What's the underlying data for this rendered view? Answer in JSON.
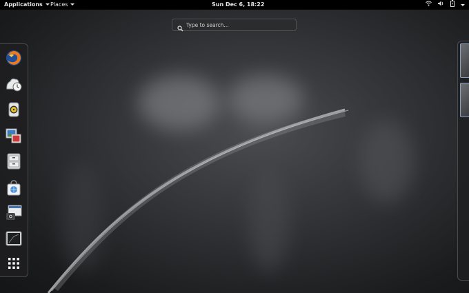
{
  "topbar": {
    "applications_label": "Applications",
    "places_label": "Places",
    "clock": "Sun Dec  6, 18:22",
    "status_icons": [
      "wifi-icon",
      "volume-icon",
      "battery-icon",
      "chevron-down-icon"
    ]
  },
  "search": {
    "placeholder": "Type to search..."
  },
  "dash": {
    "items": [
      "firefox-icon",
      "evolution-icon",
      "rhythmbox-icon",
      "shotwell-icon",
      "files-icon",
      "software-icon",
      "screenshot-icon",
      "terminal-icon",
      "show-apps-icon"
    ]
  },
  "workspaces": {
    "count": 2
  }
}
